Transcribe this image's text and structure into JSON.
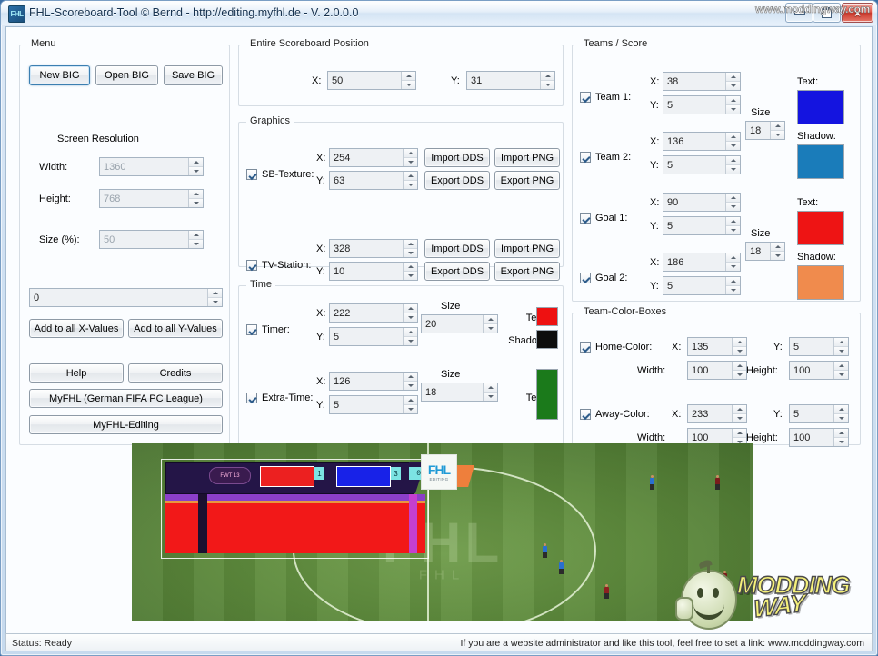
{
  "window": {
    "title": "FHL-Scoreboard-Tool © Bernd - http://editing.myfhl.de - V. 2.0.0.0",
    "icon": "app-icon",
    "minimize": "minimize-icon",
    "maximize": "maximize-icon",
    "close": "×"
  },
  "menu": {
    "title": "Menu",
    "new_big": "New BIG",
    "open_big": "Open BIG",
    "save_big": "Save BIG",
    "screen_resolution": "Screen Resolution",
    "width_label": "Width:",
    "width_value": "1360",
    "height_label": "Height:",
    "height_value": "768",
    "size_label": "Size (%):",
    "size_value": "50",
    "offset_value": "0",
    "add_x": "Add to all X-Values",
    "add_y": "Add to all Y-Values",
    "help": "Help",
    "credits": "Credits",
    "myfhl": "MyFHL (German FIFA PC League)",
    "myfhl_editing": "MyFHL-Editing"
  },
  "scoreboard_position": {
    "title": "Entire Scoreboard Position",
    "x_label": "X:",
    "x_value": "50",
    "y_label": "Y:",
    "y_value": "31"
  },
  "graphics": {
    "title": "Graphics",
    "x_label": "X:",
    "y_label": "Y:",
    "import_dds": "Import DDS",
    "export_dds": "Export DDS",
    "import_png": "Import PNG",
    "export_png": "Export PNG",
    "items": [
      {
        "label": "SB-Texture:",
        "checked": true,
        "x": "254",
        "y": "63"
      },
      {
        "label": "TV-Station:",
        "checked": true,
        "x": "328",
        "y": "10"
      }
    ]
  },
  "time": {
    "title": "Time",
    "x_label": "X:",
    "y_label": "Y:",
    "size_label": "Size",
    "text_label": "Text:",
    "shadow_label": "Shadow:",
    "timer": {
      "label": "Timer:",
      "checked": true,
      "x": "222",
      "y": "5",
      "size": "20",
      "text_color": "#ee1111",
      "shadow_color": "#0d0d0d"
    },
    "extra_time": {
      "label": "Extra-Time:",
      "checked": true,
      "x": "126",
      "y": "5",
      "size": "18",
      "text_color": "#1b7a1b"
    }
  },
  "teams_score": {
    "title": "Teams / Score",
    "x_label": "X:",
    "y_label": "Y:",
    "size_label": "Size",
    "text_label": "Text:",
    "shadow_label": "Shadow:",
    "team1": {
      "label": "Team 1:",
      "checked": true,
      "x": "38",
      "y": "5"
    },
    "team2": {
      "label": "Team 2:",
      "checked": true,
      "x": "136",
      "y": "5"
    },
    "team_size": "18",
    "team_text_color": "#1414e0",
    "team_shadow_color": "#1a7cba",
    "goal1": {
      "label": "Goal 1:",
      "checked": true,
      "x": "90",
      "y": "5"
    },
    "goal2": {
      "label": "Goal 2:",
      "checked": true,
      "x": "186",
      "y": "5"
    },
    "goal_size": "18",
    "goal_text_color": "#ee1414",
    "goal_shadow_color": "#f08b4d"
  },
  "team_color_boxes": {
    "title": "Team-Color-Boxes",
    "x_label": "X:",
    "y_label": "Y:",
    "width_label": "Width:",
    "height_label": "Height:",
    "home": {
      "label": "Home-Color:",
      "checked": true,
      "x": "135",
      "y": "5",
      "w": "100",
      "h": "100"
    },
    "away": {
      "label": "Away-Color:",
      "checked": true,
      "x": "233",
      "y": "5",
      "w": "100",
      "h": "100"
    }
  },
  "preview": {
    "name": "scoreboard-preview",
    "tv_logo_main": "FHL",
    "tv_logo_sub": "EDITING",
    "sb_logo": "FWT 13",
    "score_home": "1",
    "score_away": "3",
    "clock": "00:00",
    "pitch_logo": "FHL"
  },
  "watermark": {
    "line1": "MODDING",
    "line2": "WAY",
    "url": "www.moddingway.com"
  },
  "statusbar": {
    "left": "Status: Ready",
    "right": "If you are a website administrator and like this tool, feel free to set a link: www.moddingway.com"
  }
}
